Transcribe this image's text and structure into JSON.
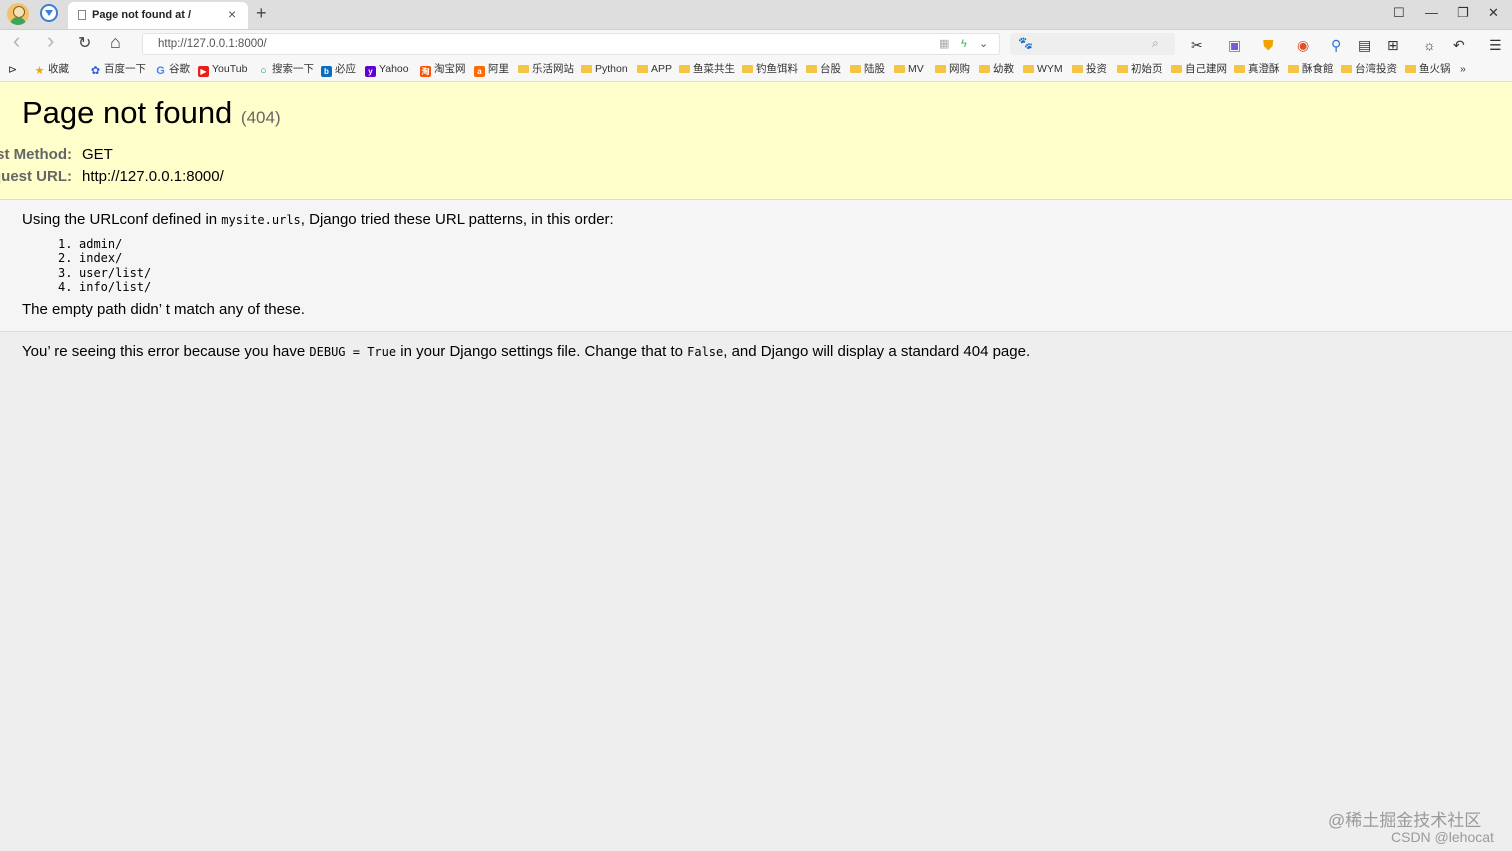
{
  "browser": {
    "tab_title": "Page not found at /",
    "tab_close": "×",
    "new_tab": "+",
    "url": "http://127.0.0.1:8000/",
    "window_controls": {
      "menu": "☐",
      "minimize": "—",
      "restore": "❐",
      "close": "✕"
    },
    "nav": {
      "back": "‹",
      "forward": "›",
      "reload": "↻",
      "home": "⌂"
    }
  },
  "bookmarks": {
    "expand": "⊳",
    "more": "»",
    "items": [
      {
        "label": "收藏",
        "icon": "star-icon"
      },
      {
        "label": "百度一下",
        "icon": "baidu-icon"
      },
      {
        "label": "谷歌",
        "icon": "google-icon"
      },
      {
        "label": "YouTub",
        "icon": "youtube-icon"
      },
      {
        "label": "搜索一下",
        "icon": "search-icon"
      },
      {
        "label": "必应",
        "icon": "bing-icon"
      },
      {
        "label": "Yahoo",
        "icon": "yahoo-icon"
      },
      {
        "label": "淘宝网",
        "icon": "taobao-icon"
      },
      {
        "label": "阿里",
        "icon": "ali-icon"
      },
      {
        "label": "乐活网站",
        "icon": "folder-icon"
      },
      {
        "label": "Python",
        "icon": "folder-icon"
      },
      {
        "label": "APP",
        "icon": "folder-icon"
      },
      {
        "label": "鱼菜共生",
        "icon": "folder-icon"
      },
      {
        "label": "钓鱼饵料",
        "icon": "folder-icon"
      },
      {
        "label": "台股",
        "icon": "folder-icon"
      },
      {
        "label": "陆股",
        "icon": "folder-icon"
      },
      {
        "label": "MV",
        "icon": "folder-icon"
      },
      {
        "label": "网购",
        "icon": "folder-icon"
      },
      {
        "label": "幼教",
        "icon": "folder-icon"
      },
      {
        "label": "WYM",
        "icon": "folder-icon"
      },
      {
        "label": "投资",
        "icon": "folder-icon"
      },
      {
        "label": "初始页",
        "icon": "folder-icon"
      },
      {
        "label": "自己建网",
        "icon": "folder-icon"
      },
      {
        "label": "真澄酥",
        "icon": "folder-icon"
      },
      {
        "label": "酥食館",
        "icon": "folder-icon"
      },
      {
        "label": "台湾投资",
        "icon": "folder-icon"
      },
      {
        "label": "鱼火锅",
        "icon": "folder-icon"
      }
    ]
  },
  "page": {
    "heading": "Page not found",
    "status_code": "(404)",
    "request_method_label": "Request Method:",
    "request_method": "GET",
    "request_url_label": "Request URL:",
    "request_url": "http://127.0.0.1:8000/",
    "intro_before": "Using the URLconf defined in ",
    "urlconf": "mysite.urls",
    "intro_after": ", Django tried these URL patterns, in this order:",
    "patterns": [
      {
        "num": "1.",
        "path": "admin/"
      },
      {
        "num": "2.",
        "path": "index/"
      },
      {
        "num": "3.",
        "path": "user/list/"
      },
      {
        "num": "4.",
        "path": "info/list/"
      }
    ],
    "no_match": "The empty path didn’ t match any of these.",
    "explain_1": "You’ re seeing this error because you have ",
    "debug_setting": "DEBUG = True",
    "explain_2": " in your Django settings file. Change that to ",
    "false_value": "False",
    "explain_3": ", and Django will display a standard 404 page."
  },
  "watermark": {
    "line1": "@稀土掘金技术社区",
    "line2": "CSDN @lehocat"
  }
}
